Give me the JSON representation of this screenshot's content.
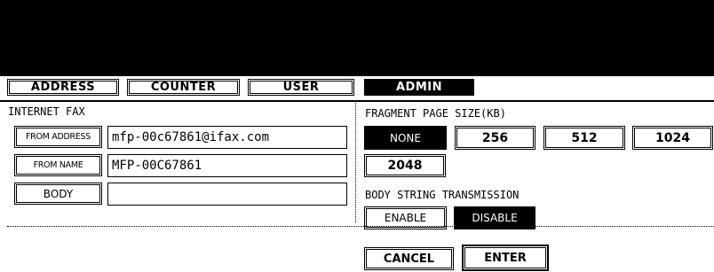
{
  "tabs": [
    {
      "label": "ADDRESS",
      "active": false
    },
    {
      "label": "COUNTER",
      "active": false
    },
    {
      "label": "USER",
      "active": false
    },
    {
      "label": "ADMIN",
      "active": true
    }
  ],
  "internet_fax": {
    "section_title": "INTERNET FAX",
    "from_address": {
      "button_label": "FROM ADDRESS",
      "value": "mfp-00c67861@ifax.com"
    },
    "from_name": {
      "button_label": "FROM NAME",
      "value": "MFP-00C67861"
    },
    "body": {
      "button_label": "BODY",
      "value": ""
    }
  },
  "fragment_page_size": {
    "title": "FRAGMENT PAGE SIZE(KB)",
    "options": [
      "NONE",
      "256",
      "512",
      "1024",
      "2048"
    ],
    "selected": "NONE"
  },
  "body_string_transmission": {
    "title": "BODY STRING TRANSMISSION",
    "options": [
      "ENABLE",
      "DISABLE"
    ],
    "selected": "DISABLE"
  },
  "footer": {
    "cancel_label": "CANCEL",
    "enter_label": "ENTER"
  }
}
